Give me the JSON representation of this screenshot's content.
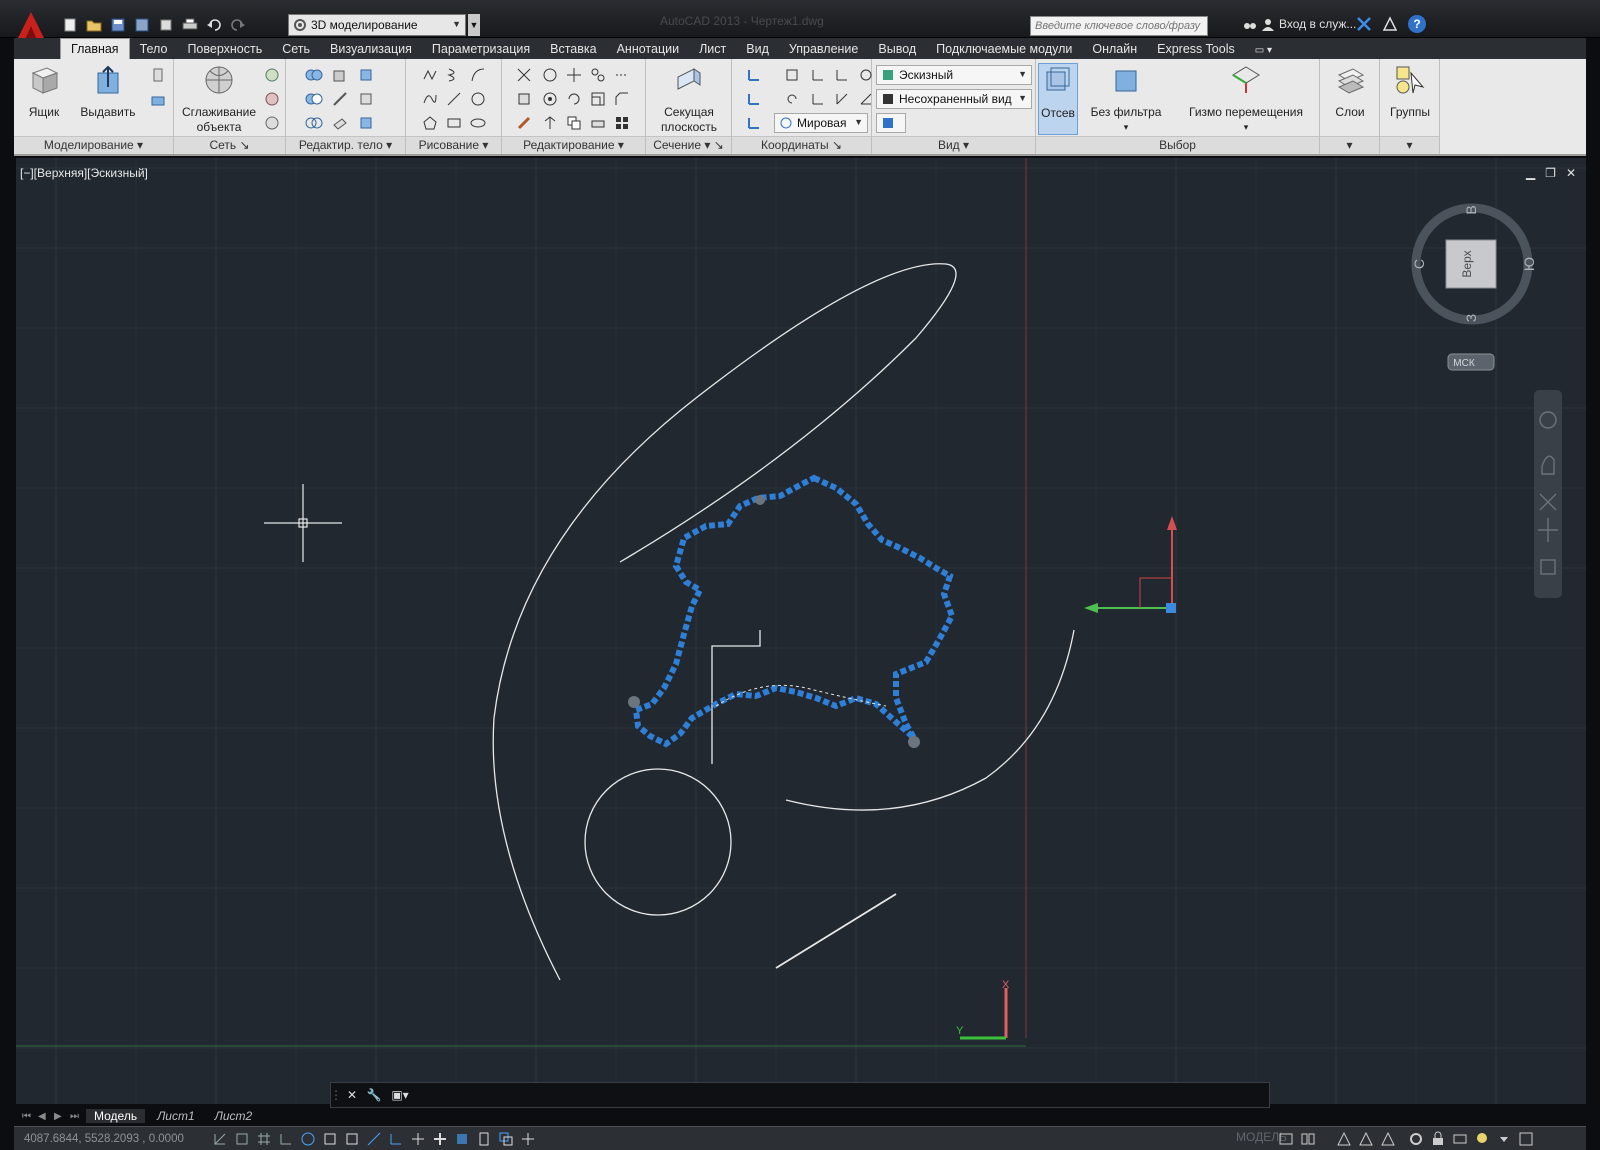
{
  "titlebar": {
    "workspace": "3D моделирование",
    "title": "AutoCAD 2013 - Чертеж1.dwg",
    "search_placeholder": "Введите ключевое слово/фразу",
    "signin": "Вход в служ..."
  },
  "tabs": [
    "Главная",
    "Тело",
    "Поверхность",
    "Сеть",
    "Визуализация",
    "Параметризация",
    "Вставка",
    "Аннотации",
    "Лист",
    "Вид",
    "Управление",
    "Вывод",
    "Подключаемые модули",
    "Онлайн",
    "Express Tools"
  ],
  "ribbon": {
    "box_label": "Ящик",
    "extrude_label": "Выдавить",
    "smooth_label": "Сглаживание объекта",
    "section_label": "Секущая плоскость",
    "visual_style": "Эскизный",
    "view_name": "Несохраненный вид",
    "ucs": "Мировая",
    "culling_label": "Отсев",
    "nofilter_label": "Без фильтра",
    "gizmo_label": "Гизмо перемещения",
    "layers_label": "Слои",
    "groups_label": "Группы",
    "groups": {
      "modeling": "Моделирование",
      "mesh": "Сеть",
      "solid_edit": "Редактир. тело",
      "draw": "Рисование",
      "modify": "Редактирование",
      "section": "Сечение",
      "coordinates": "Координаты",
      "view": "Вид",
      "selection": "Выбор"
    }
  },
  "viewport": {
    "label": "[−][Верхняя][Эскизный]",
    "viewcube": {
      "top": "Верх",
      "north": "В",
      "south": "З",
      "west": "С",
      "east": "Ю",
      "wcs": "МСК"
    },
    "ucs_x": "X",
    "ucs_y": "Y"
  },
  "layout_tabs": [
    "Модель",
    "Лист1",
    "Лист2"
  ],
  "status": {
    "coords": "4087.6844, 5528.2093 , 0.0000",
    "model": "МОДЕЛЬ"
  },
  "colors": {
    "accent": "#2f7fd6",
    "viewport_bg": "#212830",
    "ribbon_bg": "#e9e9e9"
  }
}
